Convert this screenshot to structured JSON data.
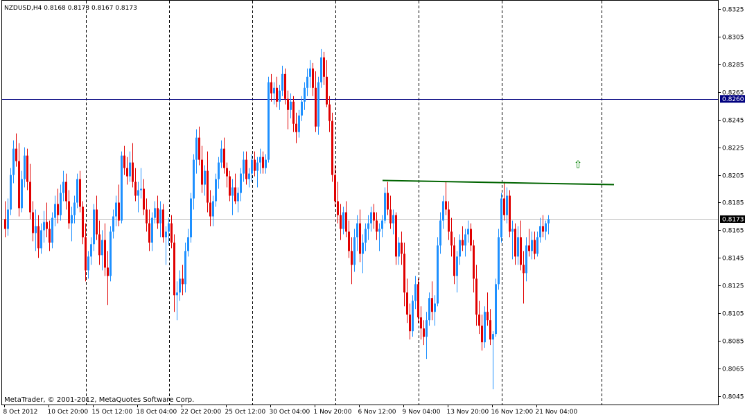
{
  "chart_data": {
    "type": "candlestick",
    "symbol_info": "NZDUSD,H4  0.8168 0.8173 0.8167 0.8173",
    "footer": "MetaTrader, © 2001-2012, MetaQuotes Software Corp.",
    "ylim": [
      0.8039,
      0.8331
    ],
    "y_ticks": [
      "0.8325",
      "0.8305",
      "0.8285",
      "0.8265",
      "0.8245",
      "0.8225",
      "0.8205",
      "0.8185",
      "0.8165",
      "0.8145",
      "0.8125",
      "0.8105",
      "0.8085",
      "0.8065",
      "0.8045"
    ],
    "x_ticks": [
      "8 Oct 2012",
      "10 Oct 20:00",
      "15 Oct 12:00",
      "18 Oct 04:00",
      "22 Oct 20:00",
      "25 Oct 12:00",
      "30 Oct 04:00",
      "1 Nov 20:00",
      "6 Nov 12:00",
      "9 Nov 04:00",
      "13 Nov 20:00",
      "16 Nov 12:00",
      "21 Nov 04:00"
    ],
    "x_tick_bars": [
      0,
      16,
      32,
      48,
      64,
      80,
      96,
      112,
      128,
      144,
      160,
      176,
      192
    ],
    "period_separators_bars": [
      29.5,
      59.5,
      89.5,
      119.5,
      149.5,
      179.5,
      215.5
    ],
    "h_line": {
      "value": 0.826,
      "label": "0.8260",
      "color": "#00007f"
    },
    "current_price": {
      "value": 0.8173,
      "label": "0.8173"
    },
    "trendline": {
      "from": [
        136.5,
        0.8201
      ],
      "to": [
        220,
        0.8198
      ],
      "color": "#006400"
    },
    "arrow_marker": {
      "bar": 207,
      "value": 0.821,
      "color": "#008000",
      "symbol": "⇧"
    },
    "colors": {
      "bull": "#1e90ff",
      "bear": "#e00000",
      "axis": "#000000",
      "grid_sep": "#000000"
    },
    "candles": [
      [
        0.8173,
        0.8186,
        0.816,
        0.8166
      ],
      [
        0.8166,
        0.8188,
        0.8161,
        0.818
      ],
      [
        0.818,
        0.821,
        0.8176,
        0.8205
      ],
      [
        0.8205,
        0.823,
        0.8199,
        0.8224
      ],
      [
        0.8224,
        0.8235,
        0.8211,
        0.8215
      ],
      [
        0.8215,
        0.8228,
        0.8175,
        0.8181
      ],
      [
        0.8181,
        0.8208,
        0.8178,
        0.8202
      ],
      [
        0.8202,
        0.8225,
        0.8196,
        0.8219
      ],
      [
        0.8219,
        0.8224,
        0.8194,
        0.82
      ],
      [
        0.82,
        0.8213,
        0.8173,
        0.8178
      ],
      [
        0.8178,
        0.8186,
        0.8157,
        0.8163
      ],
      [
        0.8163,
        0.818,
        0.815,
        0.8168
      ],
      [
        0.8168,
        0.8176,
        0.8145,
        0.8152
      ],
      [
        0.8152,
        0.817,
        0.8148,
        0.8165
      ],
      [
        0.8165,
        0.8179,
        0.8156,
        0.8171
      ],
      [
        0.8171,
        0.8185,
        0.816,
        0.8166
      ],
      [
        0.8166,
        0.8172,
        0.815,
        0.8156
      ],
      [
        0.8156,
        0.8178,
        0.8152,
        0.8174
      ],
      [
        0.8174,
        0.819,
        0.8168,
        0.8184
      ],
      [
        0.8184,
        0.8195,
        0.817,
        0.8176
      ],
      [
        0.8176,
        0.8198,
        0.8172,
        0.8192
      ],
      [
        0.8192,
        0.8208,
        0.8186,
        0.82
      ],
      [
        0.82,
        0.8206,
        0.818,
        0.8186
      ],
      [
        0.8186,
        0.8194,
        0.8166,
        0.817
      ],
      [
        0.817,
        0.8182,
        0.8157,
        0.8176
      ],
      [
        0.8176,
        0.819,
        0.817,
        0.8185
      ],
      [
        0.8185,
        0.8206,
        0.8181,
        0.8202
      ],
      [
        0.8202,
        0.8208,
        0.8178,
        0.8182
      ],
      [
        0.8182,
        0.8186,
        0.8155,
        0.816
      ],
      [
        0.816,
        0.817,
        0.8128,
        0.8136
      ],
      [
        0.8136,
        0.815,
        0.813,
        0.8146
      ],
      [
        0.8146,
        0.816,
        0.814,
        0.8155
      ],
      [
        0.8155,
        0.8184,
        0.815,
        0.818
      ],
      [
        0.818,
        0.819,
        0.8158,
        0.8162
      ],
      [
        0.8162,
        0.8172,
        0.814,
        0.8147
      ],
      [
        0.8147,
        0.8165,
        0.8136,
        0.8158
      ],
      [
        0.8158,
        0.817,
        0.8132,
        0.8138
      ],
      [
        0.8138,
        0.815,
        0.8111,
        0.8132
      ],
      [
        0.8132,
        0.8168,
        0.8128,
        0.8164
      ],
      [
        0.8164,
        0.818,
        0.8159,
        0.8175
      ],
      [
        0.8175,
        0.819,
        0.8168,
        0.8185
      ],
      [
        0.8185,
        0.8198,
        0.8168,
        0.8172
      ],
      [
        0.8172,
        0.8222,
        0.817,
        0.8219
      ],
      [
        0.8219,
        0.8226,
        0.8205,
        0.821
      ],
      [
        0.821,
        0.8218,
        0.8198,
        0.8204
      ],
      [
        0.8204,
        0.8222,
        0.82,
        0.8214
      ],
      [
        0.8214,
        0.8228,
        0.8196,
        0.82
      ],
      [
        0.82,
        0.821,
        0.8186,
        0.819
      ],
      [
        0.819,
        0.82,
        0.8178,
        0.8194
      ],
      [
        0.8194,
        0.821,
        0.8188,
        0.8195
      ],
      [
        0.8195,
        0.8202,
        0.8176,
        0.818
      ],
      [
        0.818,
        0.8188,
        0.8164,
        0.817
      ],
      [
        0.817,
        0.818,
        0.815,
        0.8156
      ],
      [
        0.8156,
        0.8178,
        0.815,
        0.8174
      ],
      [
        0.8174,
        0.8186,
        0.817,
        0.8181
      ],
      [
        0.8181,
        0.819,
        0.8166,
        0.817
      ],
      [
        0.817,
        0.8186,
        0.816,
        0.818
      ],
      [
        0.818,
        0.8184,
        0.8156,
        0.816
      ],
      [
        0.816,
        0.8168,
        0.814,
        0.8164
      ],
      [
        0.8164,
        0.8174,
        0.8154,
        0.817
      ],
      [
        0.817,
        0.8176,
        0.8152,
        0.8156
      ],
      [
        0.8156,
        0.8162,
        0.8106,
        0.8118
      ],
      [
        0.8118,
        0.8128,
        0.81,
        0.812
      ],
      [
        0.812,
        0.8136,
        0.8114,
        0.813
      ],
      [
        0.813,
        0.814,
        0.8118,
        0.8126
      ],
      [
        0.8126,
        0.8156,
        0.812,
        0.815
      ],
      [
        0.815,
        0.8166,
        0.8146,
        0.816
      ],
      [
        0.816,
        0.8192,
        0.8156,
        0.8188
      ],
      [
        0.8188,
        0.822,
        0.818,
        0.8216
      ],
      [
        0.8216,
        0.8238,
        0.8206,
        0.8232
      ],
      [
        0.8232,
        0.824,
        0.8212,
        0.8216
      ],
      [
        0.8216,
        0.8226,
        0.8192,
        0.8198
      ],
      [
        0.8198,
        0.8212,
        0.819,
        0.8208
      ],
      [
        0.8208,
        0.8222,
        0.8178,
        0.8185
      ],
      [
        0.8185,
        0.8194,
        0.8168,
        0.8175
      ],
      [
        0.8175,
        0.819,
        0.8168,
        0.8186
      ],
      [
        0.8186,
        0.8206,
        0.8182,
        0.8202
      ],
      [
        0.8202,
        0.8218,
        0.8195,
        0.8214
      ],
      [
        0.8214,
        0.823,
        0.821,
        0.8224
      ],
      [
        0.8224,
        0.8232,
        0.8206,
        0.821
      ],
      [
        0.821,
        0.8214,
        0.8196,
        0.8204
      ],
      [
        0.8204,
        0.8208,
        0.8186,
        0.819
      ],
      [
        0.819,
        0.8202,
        0.8176,
        0.8196
      ],
      [
        0.8196,
        0.8206,
        0.8184,
        0.8186
      ],
      [
        0.8186,
        0.8196,
        0.8178,
        0.8192
      ],
      [
        0.8192,
        0.821,
        0.8186,
        0.8206
      ],
      [
        0.8206,
        0.8222,
        0.82,
        0.8216
      ],
      [
        0.8216,
        0.8222,
        0.8198,
        0.8202
      ],
      [
        0.8202,
        0.821,
        0.8196,
        0.8206
      ],
      [
        0.8206,
        0.822,
        0.82,
        0.8216
      ],
      [
        0.8216,
        0.8222,
        0.8204,
        0.8208
      ],
      [
        0.8208,
        0.8218,
        0.8196,
        0.8214
      ],
      [
        0.8214,
        0.8224,
        0.8206,
        0.8218
      ],
      [
        0.8218,
        0.8222,
        0.8206,
        0.821
      ],
      [
        0.821,
        0.822,
        0.8206,
        0.8216
      ],
      [
        0.8216,
        0.8276,
        0.8214,
        0.8272
      ],
      [
        0.8272,
        0.8278,
        0.8258,
        0.8264
      ],
      [
        0.8264,
        0.8272,
        0.8256,
        0.8268
      ],
      [
        0.8268,
        0.8276,
        0.8254,
        0.8258
      ],
      [
        0.8258,
        0.827,
        0.8252,
        0.8266
      ],
      [
        0.8266,
        0.8284,
        0.8262,
        0.8278
      ],
      [
        0.8278,
        0.8282,
        0.8256,
        0.826
      ],
      [
        0.826,
        0.8266,
        0.8238,
        0.8252
      ],
      [
        0.8252,
        0.8264,
        0.8246,
        0.8258
      ],
      [
        0.8258,
        0.8262,
        0.8236,
        0.8242
      ],
      [
        0.8242,
        0.825,
        0.8228,
        0.8236
      ],
      [
        0.8236,
        0.8252,
        0.8232,
        0.8248
      ],
      [
        0.8248,
        0.8262,
        0.8244,
        0.8258
      ],
      [
        0.8258,
        0.8272,
        0.8252,
        0.8268
      ],
      [
        0.8268,
        0.8282,
        0.8262,
        0.8276
      ],
      [
        0.8276,
        0.8288,
        0.8268,
        0.8282
      ],
      [
        0.8282,
        0.8286,
        0.8262,
        0.8268
      ],
      [
        0.8268,
        0.828,
        0.8236,
        0.824
      ],
      [
        0.824,
        0.8276,
        0.8234,
        0.8272
      ],
      [
        0.8272,
        0.8296,
        0.8268,
        0.829
      ],
      [
        0.829,
        0.8294,
        0.827,
        0.8276
      ],
      [
        0.8276,
        0.8288,
        0.8254,
        0.8256
      ],
      [
        0.8256,
        0.8262,
        0.8236,
        0.8244
      ],
      [
        0.8244,
        0.825,
        0.82,
        0.8205
      ],
      [
        0.8205,
        0.8212,
        0.8182,
        0.8186
      ],
      [
        0.8186,
        0.82,
        0.817,
        0.8176
      ],
      [
        0.8176,
        0.8184,
        0.8158,
        0.8166
      ],
      [
        0.8166,
        0.8182,
        0.8162,
        0.8178
      ],
      [
        0.8178,
        0.8186,
        0.816,
        0.8164
      ],
      [
        0.8164,
        0.8172,
        0.8145,
        0.815
      ],
      [
        0.815,
        0.816,
        0.8126,
        0.814
      ],
      [
        0.814,
        0.8166,
        0.8135,
        0.816
      ],
      [
        0.816,
        0.8176,
        0.815,
        0.817
      ],
      [
        0.817,
        0.818,
        0.8142,
        0.8148
      ],
      [
        0.8148,
        0.8162,
        0.8134,
        0.8156
      ],
      [
        0.8156,
        0.817,
        0.815,
        0.8166
      ],
      [
        0.8166,
        0.8176,
        0.8158,
        0.817
      ],
      [
        0.817,
        0.8182,
        0.8164,
        0.8178
      ],
      [
        0.8178,
        0.8184,
        0.8166,
        0.8172
      ],
      [
        0.8172,
        0.8178,
        0.8158,
        0.8164
      ],
      [
        0.8164,
        0.817,
        0.815,
        0.8166
      ],
      [
        0.8166,
        0.8176,
        0.816,
        0.8172
      ],
      [
        0.8172,
        0.8196,
        0.817,
        0.8192
      ],
      [
        0.8192,
        0.82,
        0.8176,
        0.818
      ],
      [
        0.818,
        0.819,
        0.8166,
        0.817
      ],
      [
        0.817,
        0.818,
        0.8162,
        0.8176
      ],
      [
        0.8176,
        0.8178,
        0.814,
        0.8146
      ],
      [
        0.8146,
        0.816,
        0.814,
        0.8156
      ],
      [
        0.8156,
        0.8164,
        0.814,
        0.8148
      ],
      [
        0.8148,
        0.8156,
        0.811,
        0.812
      ],
      [
        0.812,
        0.813,
        0.8098,
        0.8104
      ],
      [
        0.8104,
        0.8112,
        0.8086,
        0.8092
      ],
      [
        0.8092,
        0.8118,
        0.8088,
        0.8114
      ],
      [
        0.8114,
        0.8132,
        0.8108,
        0.8126
      ],
      [
        0.8126,
        0.813,
        0.8098,
        0.8102
      ],
      [
        0.8102,
        0.811,
        0.8086,
        0.8094
      ],
      [
        0.8094,
        0.81,
        0.8082,
        0.8088
      ],
      [
        0.8088,
        0.8106,
        0.8072,
        0.81
      ],
      [
        0.81,
        0.812,
        0.8096,
        0.8116
      ],
      [
        0.8116,
        0.8128,
        0.81,
        0.8106
      ],
      [
        0.8106,
        0.8118,
        0.8096,
        0.8112
      ],
      [
        0.8112,
        0.816,
        0.811,
        0.8154
      ],
      [
        0.8154,
        0.8178,
        0.8148,
        0.8172
      ],
      [
        0.8172,
        0.819,
        0.8166,
        0.8186
      ],
      [
        0.8186,
        0.82,
        0.8176,
        0.818
      ],
      [
        0.818,
        0.8186,
        0.8158,
        0.8164
      ],
      [
        0.8164,
        0.8174,
        0.8146,
        0.8154
      ],
      [
        0.8154,
        0.816,
        0.8126,
        0.8132
      ],
      [
        0.8132,
        0.815,
        0.812,
        0.8146
      ],
      [
        0.8146,
        0.8162,
        0.814,
        0.8158
      ],
      [
        0.8158,
        0.8168,
        0.815,
        0.8154
      ],
      [
        0.8154,
        0.8166,
        0.8146,
        0.8162
      ],
      [
        0.8162,
        0.8172,
        0.8156,
        0.8166
      ],
      [
        0.8166,
        0.817,
        0.815,
        0.8154
      ],
      [
        0.8154,
        0.8158,
        0.812,
        0.813
      ],
      [
        0.813,
        0.814,
        0.8096,
        0.8104
      ],
      [
        0.8104,
        0.8114,
        0.809,
        0.8096
      ],
      [
        0.8096,
        0.8104,
        0.8078,
        0.8084
      ],
      [
        0.8084,
        0.811,
        0.808,
        0.8106
      ],
      [
        0.8106,
        0.812,
        0.8096,
        0.81
      ],
      [
        0.81,
        0.8108,
        0.8082,
        0.8086
      ],
      [
        0.8086,
        0.8092,
        0.805,
        0.809
      ],
      [
        0.809,
        0.813,
        0.8088,
        0.8126
      ],
      [
        0.8126,
        0.8166,
        0.8122,
        0.816
      ],
      [
        0.816,
        0.8192,
        0.8156,
        0.8188
      ],
      [
        0.8188,
        0.82,
        0.8172,
        0.8176
      ],
      [
        0.8176,
        0.8196,
        0.817,
        0.819
      ],
      [
        0.819,
        0.8194,
        0.816,
        0.8164
      ],
      [
        0.8164,
        0.8172,
        0.8144,
        0.8166
      ],
      [
        0.8166,
        0.817,
        0.814,
        0.8146
      ],
      [
        0.8146,
        0.8168,
        0.814,
        0.816
      ],
      [
        0.816,
        0.8172,
        0.8136,
        0.814
      ],
      [
        0.814,
        0.815,
        0.8112,
        0.8134
      ],
      [
        0.8134,
        0.816,
        0.8128,
        0.8154
      ],
      [
        0.8154,
        0.8166,
        0.8146,
        0.815
      ],
      [
        0.815,
        0.8164,
        0.8144,
        0.8158
      ],
      [
        0.8158,
        0.8164,
        0.8144,
        0.8148
      ],
      [
        0.8148,
        0.8164,
        0.8146,
        0.816
      ],
      [
        0.816,
        0.8174,
        0.8156,
        0.8168
      ],
      [
        0.8168,
        0.8176,
        0.816,
        0.8164
      ],
      [
        0.8164,
        0.8172,
        0.8158,
        0.817
      ],
      [
        0.817,
        0.8176,
        0.8162,
        0.8173
      ]
    ]
  }
}
